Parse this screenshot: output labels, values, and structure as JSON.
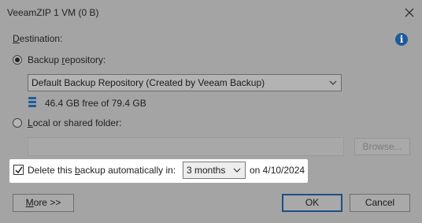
{
  "window": {
    "title": "VeeamZIP 1 VM (0 B)"
  },
  "destination": {
    "label": "Destination:",
    "repo_option": {
      "before": "Backup ",
      "accel": "r",
      "after": "epository:",
      "selected": true
    },
    "repo_select": {
      "value": "Default Backup Repository (Created by Veeam Backup)"
    },
    "repo_space": "46.4 GB free of 79.4 GB",
    "folder_option": {
      "accel": "L",
      "after": "ocal or shared folder:",
      "selected": false
    },
    "folder_path": {
      "value": ""
    },
    "browse_label": "Browse..."
  },
  "auto_delete": {
    "checked": true,
    "label_before": "Delete this ",
    "label_accel": "b",
    "label_after": "ackup automatically in:",
    "period": "3 months",
    "date_text": "on 4/10/2024"
  },
  "buttons": {
    "more": {
      "accel": "M",
      "after": "ore >>"
    },
    "ok": "OK",
    "cancel": "Cancel"
  },
  "icons": {
    "info": "info-icon",
    "close": "close-icon",
    "database": "database-icon",
    "checkmark": "checkmark-icon",
    "chevron": "chevron-down-icon"
  },
  "colors": {
    "info_blue": "#1f5b9c",
    "default_button_border": "#1c4e86",
    "highlight": "#ffffff"
  }
}
